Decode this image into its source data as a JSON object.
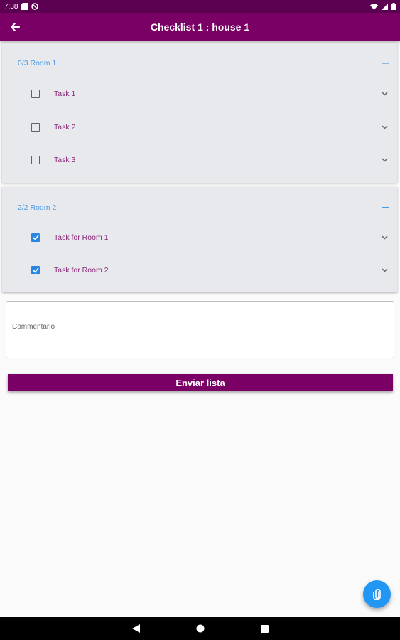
{
  "status_bar": {
    "time": "7:38",
    "icons": [
      "sd-card-icon",
      "no-sync-icon",
      "wifi-icon",
      "signal-icon",
      "battery-icon"
    ]
  },
  "app_bar": {
    "title": "Checklist 1 : house 1",
    "back_icon": "arrow-left-icon"
  },
  "colors": {
    "primary": "#7b0066",
    "status_bar": "#5c0051",
    "accent": "#2196f3",
    "section_header": "#4a9be8",
    "task_text": "#8a2b7a",
    "section_bg": "#e8e9ed"
  },
  "sections": [
    {
      "title": "0/3 Room 1",
      "tasks": [
        {
          "label": "Task 1",
          "checked": false
        },
        {
          "label": "Task 2",
          "checked": false
        },
        {
          "label": "Task 3",
          "checked": false
        }
      ]
    },
    {
      "title": "2/2 Room 2",
      "tasks": [
        {
          "label": "Task for Room 1",
          "checked": true
        },
        {
          "label": "Task for Room 2",
          "checked": true
        }
      ]
    }
  ],
  "comment": {
    "placeholder": "Commentario",
    "value": ""
  },
  "submit_button": {
    "label": "Enviar lista"
  },
  "fab": {
    "icon": "paperclip-icon"
  },
  "nav_bar": {
    "icons": [
      "back-triangle-icon",
      "home-circle-icon",
      "recents-square-icon"
    ]
  }
}
